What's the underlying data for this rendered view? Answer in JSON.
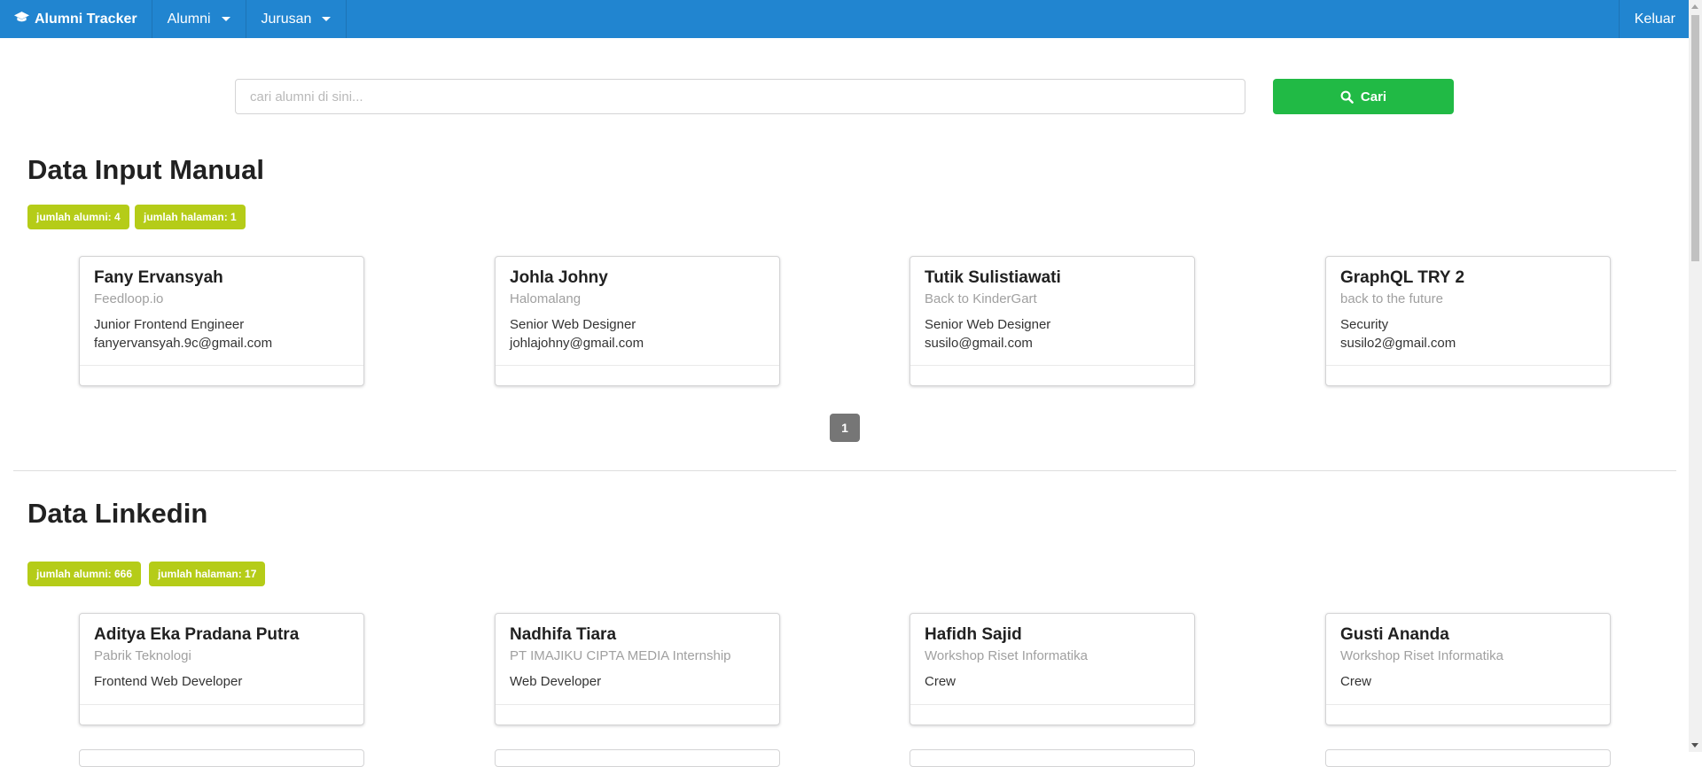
{
  "navbar": {
    "brand": "Alumni Tracker",
    "menu": [
      {
        "label": "Alumni"
      },
      {
        "label": "Jurusan"
      }
    ],
    "logout": "Keluar"
  },
  "search": {
    "placeholder": "cari alumni di sini...",
    "value": "",
    "button_label": "Cari"
  },
  "manual": {
    "title": "Data Input Manual",
    "badges": [
      "jumlah alumni: 4",
      "jumlah halaman: 1"
    ],
    "cards": [
      {
        "name": "Fany Ervansyah",
        "company": "Feedloop.io",
        "position": "Junior Frontend Engineer",
        "email": "fanyervansyah.9c@gmail.com"
      },
      {
        "name": "Johla Johny",
        "company": "Halomalang",
        "position": "Senior Web Designer",
        "email": "johlajohny@gmail.com"
      },
      {
        "name": "Tutik Sulistiawati",
        "company": "Back to KinderGart",
        "position": "Senior Web Designer",
        "email": "susilo@gmail.com"
      },
      {
        "name": "GraphQL TRY 2",
        "company": "back to the future",
        "position": "Security",
        "email": "susilo2@gmail.com"
      }
    ],
    "page": "1"
  },
  "linkedin": {
    "title": "Data Linkedin",
    "badges": [
      "jumlah alumni: 666",
      "jumlah halaman: 17"
    ],
    "cards": [
      {
        "name": "Aditya Eka Pradana Putra",
        "company": "Pabrik Teknologi",
        "position": "Frontend Web Developer"
      },
      {
        "name": "Nadhifa Tiara",
        "company": "PT IMAJIKU CIPTA MEDIA Internship",
        "position": "Web Developer"
      },
      {
        "name": "Hafidh Sajid",
        "company": "Workshop Riset Informatika",
        "position": "Crew"
      },
      {
        "name": "Gusti Ananda",
        "company": "Workshop Riset Informatika",
        "position": "Crew"
      }
    ]
  },
  "colors": {
    "navbar": "#2185d0",
    "search_button": "#21ba45",
    "badge": "#b5cc18",
    "pager": "#767676"
  }
}
